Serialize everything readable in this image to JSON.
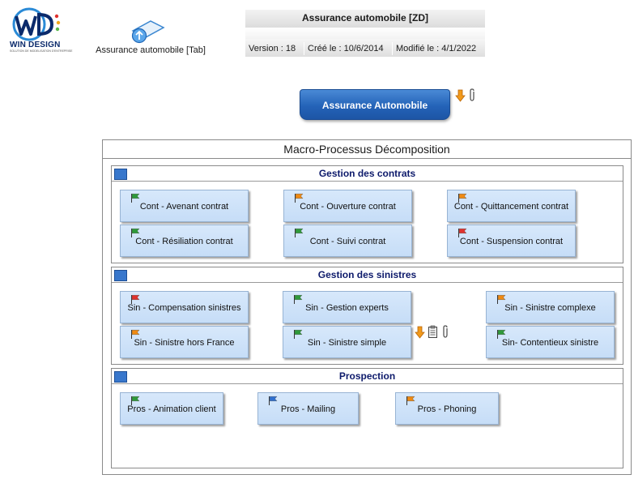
{
  "logo": {
    "text": "WIN DESIGN",
    "tagline": "SOLUTION DE MODELISATION D'ENTREPRISE"
  },
  "tab_link": {
    "label": "Assurance automobile [Tab]",
    "icon": "tab-shortcut-icon"
  },
  "header": {
    "title": "Assurance automobile [ZD]",
    "version": "Version : 18",
    "created": "Créé le : 10/6/2014",
    "modified": "Modifié le : 4/1/2022"
  },
  "main_button": {
    "label": "Assurance Automobile"
  },
  "decomposition": {
    "title": "Macro-Processus Décomposition"
  },
  "colors": {
    "flag_green": "#2e9a3a",
    "flag_orange": "#f08a12",
    "flag_red": "#e0322e",
    "flag_blue": "#2f6fcf"
  },
  "groups": [
    {
      "title": "Gestion des contrats",
      "items": [
        {
          "label": "Cont - Avenant contrat",
          "flag": "green"
        },
        {
          "label": "Cont - Ouverture contrat",
          "flag": "orange"
        },
        {
          "label": "Cont - Quittancement contrat",
          "flag": "orange"
        },
        {
          "label": "Cont - Résiliation contrat",
          "flag": "green"
        },
        {
          "label": "Cont - Suivi contrat",
          "flag": "green"
        },
        {
          "label": "Cont - Suspension contrat",
          "flag": "red"
        }
      ]
    },
    {
      "title": "Gestion des sinistres",
      "items": [
        {
          "label": "Sin - Compensation sinistres",
          "flag": "red"
        },
        {
          "label": "Sin - Gestion experts",
          "flag": "green"
        },
        {
          "label": "Sin - Sinistre complexe",
          "flag": "orange"
        },
        {
          "label": "Sin - Sinistre hors France",
          "flag": "orange"
        },
        {
          "label": "Sin - Sinistre simple",
          "flag": "green"
        },
        {
          "label": "Sin- Contentieux sinistre",
          "flag": "green"
        }
      ]
    },
    {
      "title": "Prospection",
      "items": [
        {
          "label": "Pros - Animation client",
          "flag": "green"
        },
        {
          "label": "Pros - Mailing",
          "flag": "blue"
        },
        {
          "label": "Pros - Phoning",
          "flag": "orange"
        }
      ]
    }
  ]
}
